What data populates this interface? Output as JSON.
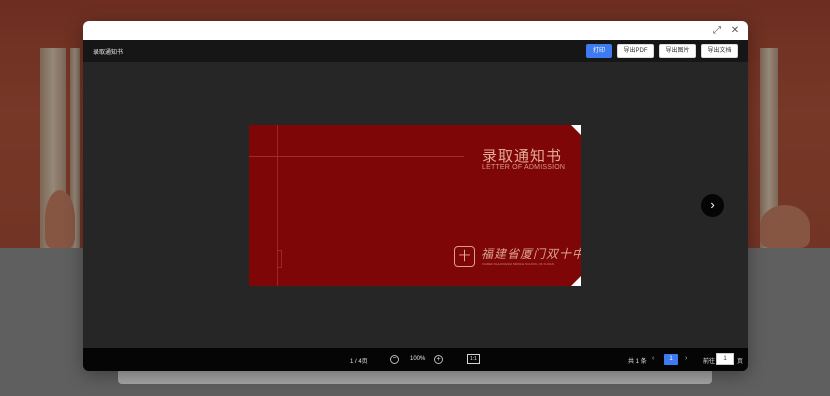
{
  "dialog": {
    "title": "录取通知书",
    "actions": {
      "print": "打印",
      "export_pdf": "导出PDF",
      "export_image": "导出图片",
      "export_doc": "导出文档"
    }
  },
  "letter": {
    "title": "录取通知书",
    "subtitle": "LETTER OF ADMISSION",
    "school_name_cn": "福建省厦门双十中学",
    "school_name_en": "XIAMEN SHUANGSHI MIDDLE SCHOOL OF FUJIAN"
  },
  "footer": {
    "page_info": "1 / 4页",
    "zoom": "100%",
    "ratio_label": "1:1",
    "total_label": "共 1 条",
    "current_page": "1",
    "goto_label": "前往",
    "goto_value": "1",
    "page_unit": "页"
  },
  "colors": {
    "accent": "#3e7bf0",
    "letter_red": "#7e0606"
  }
}
